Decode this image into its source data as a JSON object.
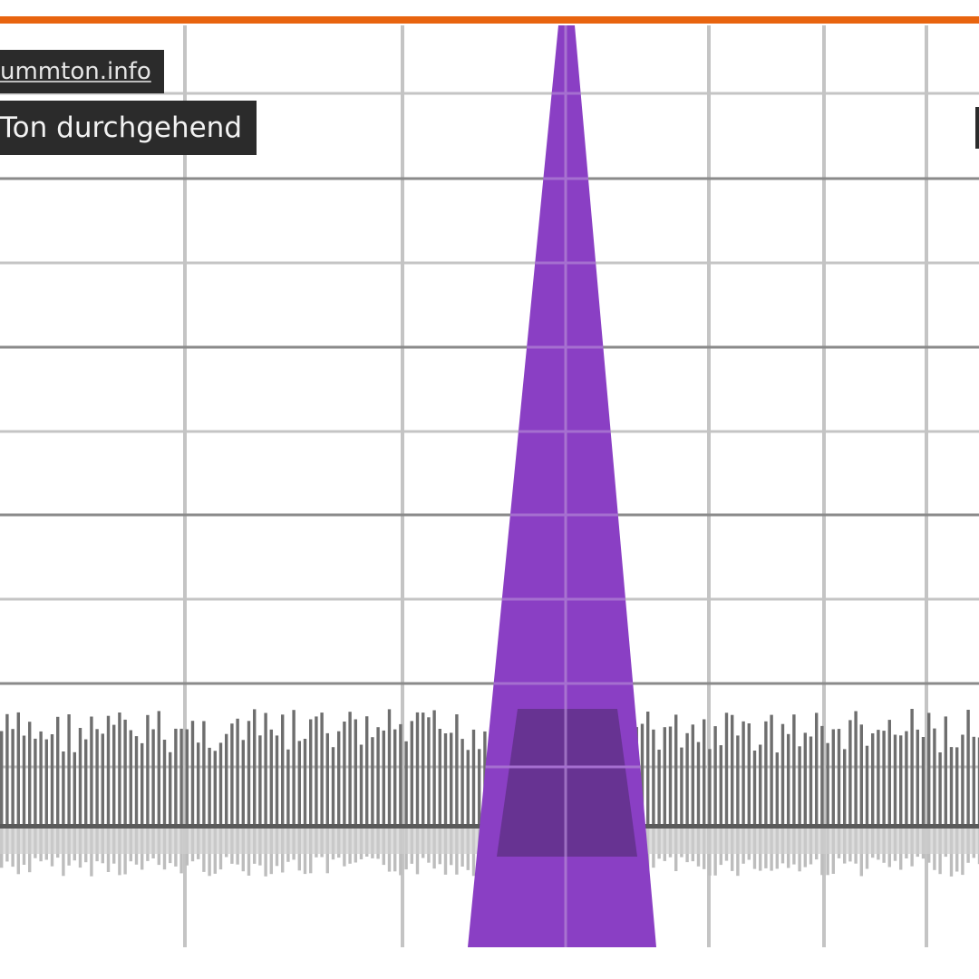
{
  "labels": {
    "site": "ummton.info",
    "track": "Ton durchgehend"
  },
  "colors": {
    "background": "#ffffff",
    "top_bar": "#e8640f",
    "grid": "#c4c4c4",
    "grid_dark": "#8a8a8a",
    "waveform_dark": "#6e6e6e",
    "waveform_light": "#bdbdbd",
    "peak": "#8a3fc4",
    "overlap": "#4a2a6a",
    "label_bg": "#2b2b2b"
  },
  "icons": {
    "edge_box": "overlay-box-icon"
  }
}
